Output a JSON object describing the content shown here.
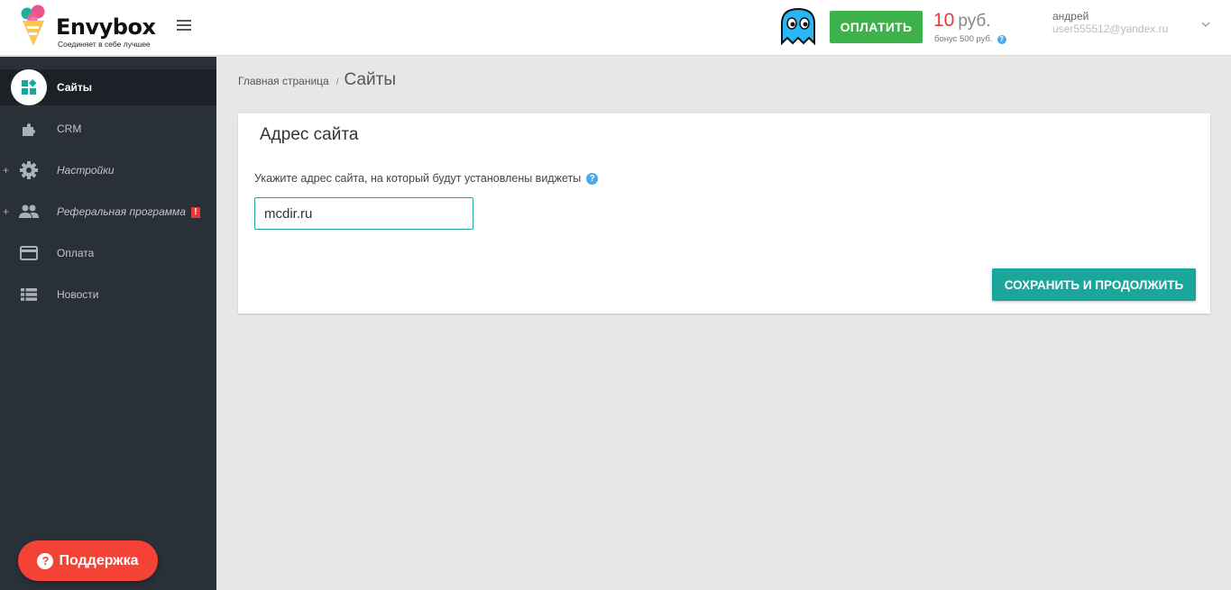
{
  "header": {
    "logo_name": "Envybox",
    "logo_tagline": "Соединяет в себе лучшее",
    "pay_button": "ОПЛАТИТЬ",
    "balance_amount": "10",
    "balance_currency": "руб.",
    "bonus": "бонус 500 руб.",
    "help_glyph": "?",
    "user_name": "андрей",
    "user_email": "user555512@yandex.ru",
    "icons": [
      "menu-icon",
      "ghost-avatar-icon",
      "chevron-down-icon"
    ],
    "colors": {
      "pay": "#3db24b",
      "balance": "#e53935"
    }
  },
  "sidebar": {
    "items": [
      {
        "label": "Сайты",
        "icon": "widgets-icon",
        "active": true
      },
      {
        "label": "CRM",
        "icon": "puzzle-icon"
      },
      {
        "label": "Настройки",
        "icon": "gear-icon",
        "expandable": "+"
      },
      {
        "label": "Реферальная программа",
        "icon": "people-icon",
        "expandable": "+",
        "badge": "!"
      },
      {
        "label": "Оплата",
        "icon": "credit-card-icon"
      },
      {
        "label": "Новости",
        "icon": "list-icon"
      }
    ],
    "support_button": "Поддержка",
    "support_glyph": "?"
  },
  "breadcrumb": {
    "home": "Главная страница",
    "separator": "/",
    "current": "Сайты"
  },
  "card": {
    "title": "Адрес сайта",
    "hint": "Укажите адрес сайта, на который будут установлены виджеты",
    "site_value": "mcdir.ru",
    "save_button": "СОХРАНИТЬ И ПРОДОЛЖИТЬ",
    "accent": "#1aa69a"
  }
}
